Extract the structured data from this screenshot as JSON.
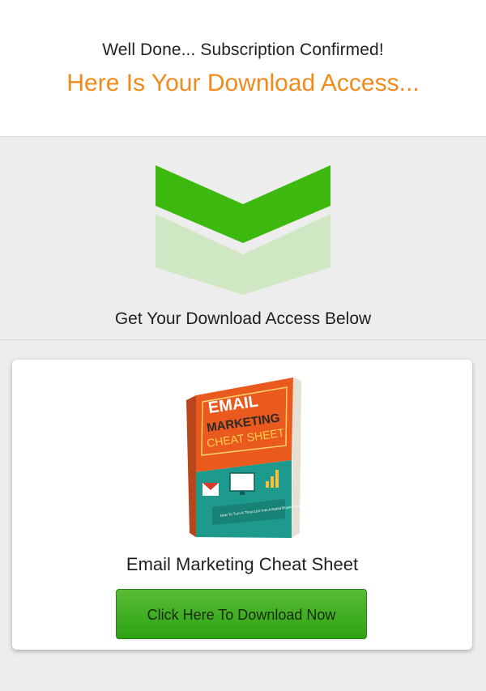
{
  "header": {
    "confirm_text": "Well Done... Subscription Confirmed!",
    "access_text": "Here Is Your Download Access..."
  },
  "arrow_section": {
    "below_text": "Get Your Download Access Below",
    "colors": {
      "primary": "#3cb80f",
      "secondary": "#cfe8c3"
    }
  },
  "product": {
    "title": "Email Marketing Cheat Sheet",
    "cover": {
      "line1": "EMAIL",
      "line2": "MARKETING",
      "line3": "CHEAT SHEET",
      "tagline": "How To Turn A 'Tired List' Into A Rabid Buyers List!"
    },
    "download_label": "Click Here To Download Now"
  },
  "colors": {
    "accent_orange": "#f08a1a",
    "button_green": "#3aae1c",
    "background": "#ededed"
  }
}
